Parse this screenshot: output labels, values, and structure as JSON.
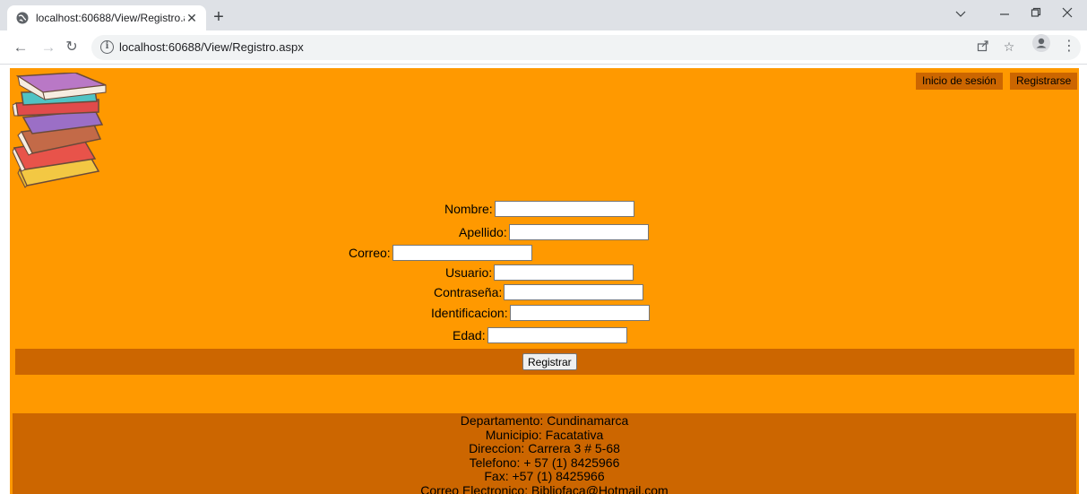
{
  "browser": {
    "tab_title": "localhost:60688/View/Registro.aspx",
    "url": "localhost:60688/View/Registro.aspx"
  },
  "header": {
    "login_link": "Inicio de sesión",
    "register_link": "Registrarse"
  },
  "form": {
    "fields": [
      {
        "label": "Nombre:",
        "value": ""
      },
      {
        "label": "Apellido:",
        "value": ""
      },
      {
        "label": "Correo:",
        "value": ""
      },
      {
        "label": "Usuario:",
        "value": ""
      },
      {
        "label": "Contraseña:",
        "value": ""
      },
      {
        "label": "Identificacion:",
        "value": ""
      },
      {
        "label": "Edad:",
        "value": ""
      }
    ],
    "submit_label": "Registrar"
  },
  "footer": {
    "lines": [
      "Departamento: Cundinamarca",
      "Municipio: Facatativa",
      "Direccion: Carrera 3 # 5-68",
      "Telefono: + 57 (1) 8425966",
      "Fax: +57 (1) 8425966",
      "Correo Electronico: Bibliofaca@Hotmail.com"
    ]
  },
  "colors": {
    "page_background": "#ff9900",
    "accent_dark": "#cc6600"
  },
  "icons": [
    "globe-icon",
    "close-icon",
    "plus-icon",
    "chevron-down-icon",
    "minimize-icon",
    "restore-icon",
    "back-arrow-icon",
    "forward-arrow-icon",
    "reload-icon",
    "info-icon",
    "share-icon",
    "star-icon",
    "profile-icon",
    "menu-dots-icon",
    "books-logo"
  ]
}
